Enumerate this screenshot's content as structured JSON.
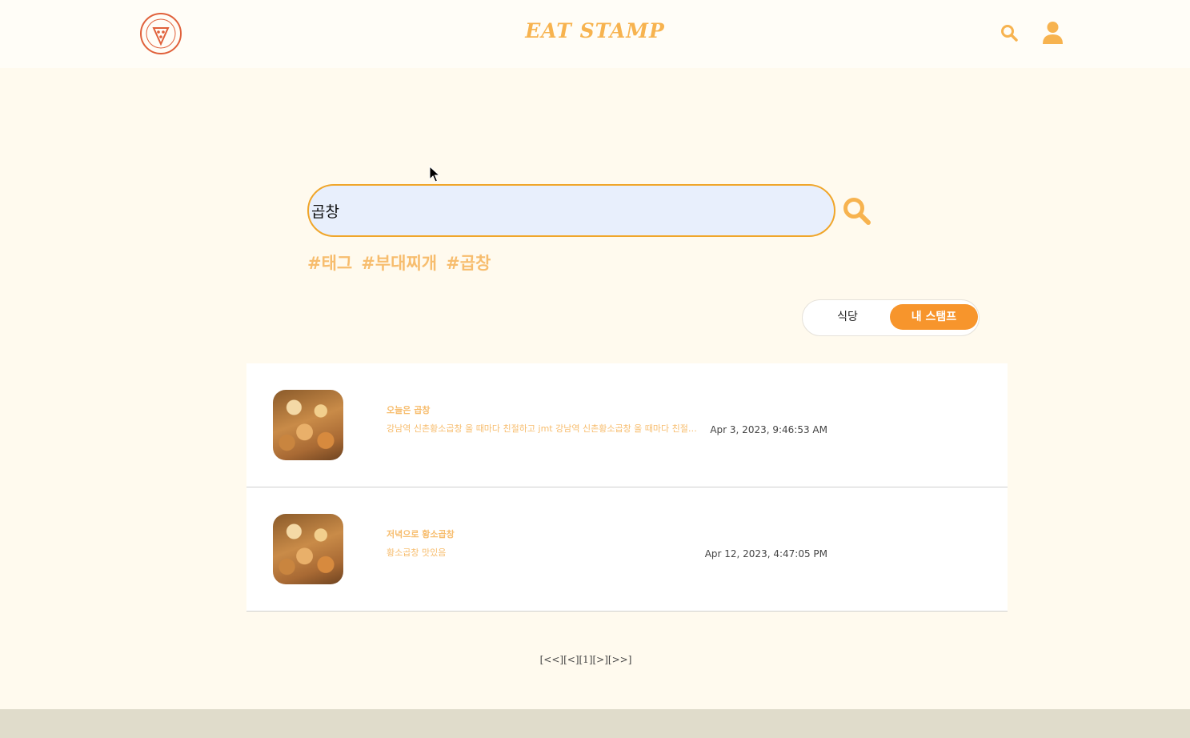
{
  "header": {
    "brand": "EAT STAMP",
    "logo_icon": "pizza-stamp-logo",
    "search_icon": "search-icon",
    "user_icon": "user-icon",
    "accent_color": "#f7b34f"
  },
  "search": {
    "value": "곱창",
    "placeholder": "",
    "button_icon": "search-icon"
  },
  "tags": [
    "#태그",
    "#부대찌개",
    "#곱창"
  ],
  "toggle": {
    "options": [
      "식당",
      "내 스탬프"
    ],
    "selected": "내 스탬프",
    "active_color": "#f7952c"
  },
  "results": [
    {
      "title": "오늘은 곱창",
      "body": "강남역 신촌황소곱창 올 때마다 친절하고 jmt 강남역 신촌황소곱창 올 때마다 친절하고 jmt",
      "date": "Apr 3, 2023, 9:46:53 AM"
    },
    {
      "title": "저녁으로 황소곱창",
      "body": "황소곱창 맛있음",
      "date": "Apr 12, 2023, 4:47:05 PM"
    }
  ],
  "pagination": {
    "first": "[<<]",
    "prev": "[<]",
    "current": "[1]",
    "next": "[>]",
    "last": "[>>]"
  }
}
